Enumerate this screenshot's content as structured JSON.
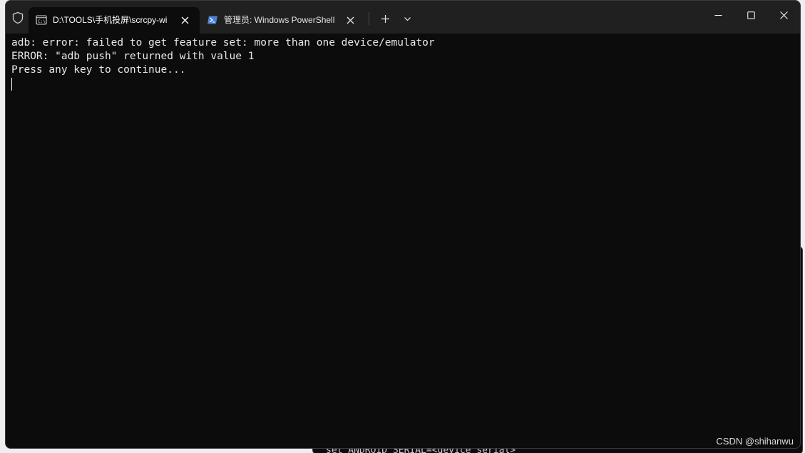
{
  "titlebar": {
    "tabs": [
      {
        "label": "D:\\TOOLS\\手机投屏\\scrcpy-wi",
        "icon": "cmd-icon",
        "active": true
      },
      {
        "label": "管理员: Windows PowerShell",
        "icon": "powershell-icon",
        "active": false
      }
    ],
    "new_tab_icon": "plus-icon",
    "dropdown_icon": "chevron-down-icon"
  },
  "window_controls": {
    "minimize_icon": "minimize-icon",
    "maximize_icon": "maximize-icon",
    "close_icon": "close-icon"
  },
  "terminal": {
    "lines": [
      "adb: error: failed to get feature set: more than one device/emulator",
      "ERROR: \"adb push\" returned with value 1",
      "Press any key to continue..."
    ]
  },
  "background_window": {
    "partial_line": "set ANDROID_SERIAL=<device_serial>"
  },
  "watermark": "CSDN @shihanwu",
  "colors": {
    "terminal_bg": "#0c0c0c",
    "titlebar_bg": "#202020",
    "text": "#e8e8e8"
  }
}
